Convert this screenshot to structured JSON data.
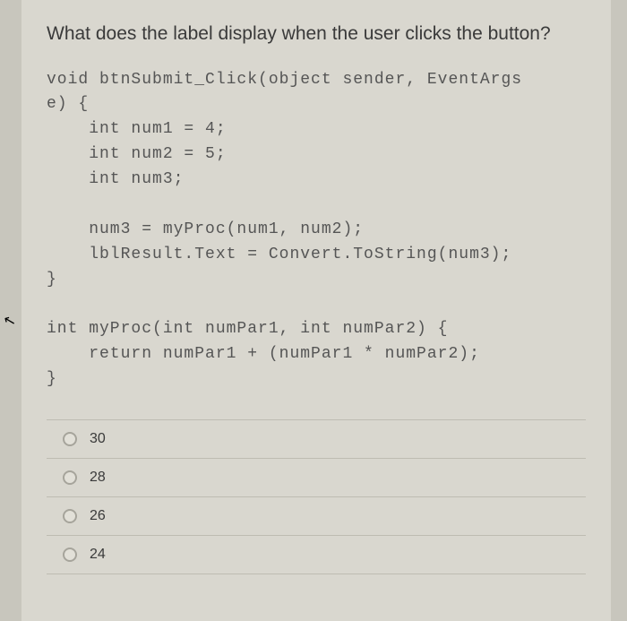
{
  "question": "What does the label display when the user clicks the button?",
  "code": "void btnSubmit_Click(object sender, EventArgs\ne) {\n    int num1 = 4;\n    int num2 = 5;\n    int num3;\n\n    num3 = myProc(num1, num2);\n    lblResult.Text = Convert.ToString(num3);\n}\n\nint myProc(int numPar1, int numPar2) {\n    return numPar1 + (numPar1 * numPar2);\n}",
  "options": [
    {
      "label": "30"
    },
    {
      "label": "28"
    },
    {
      "label": "26"
    },
    {
      "label": "24"
    }
  ]
}
